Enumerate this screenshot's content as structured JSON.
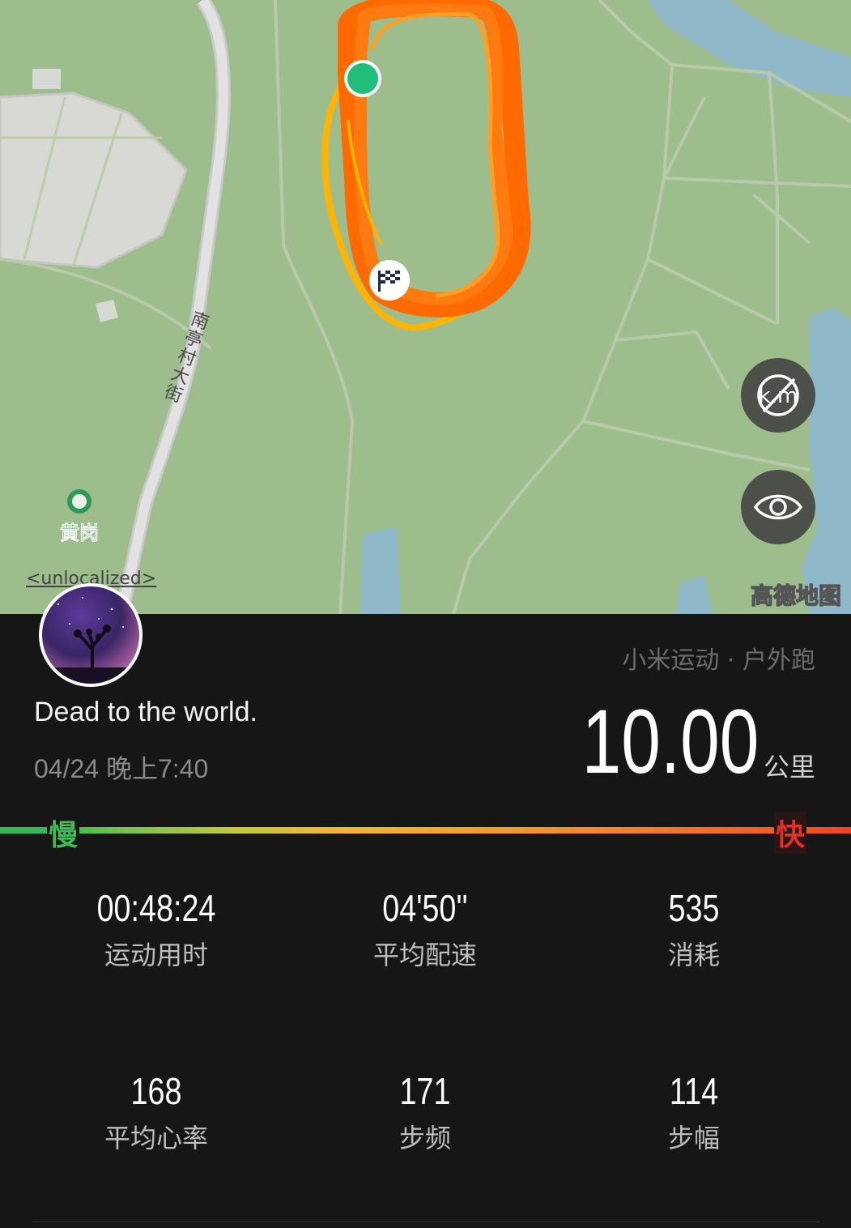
{
  "map": {
    "road_name": "南亭村大街",
    "poi_name": "黄岗",
    "unlocalized_text": "<unlocalized>",
    "provider_logo": "高德地图",
    "buttons": [
      {
        "name": "km-marker-toggle",
        "icon": "km-off-icon"
      },
      {
        "name": "visibility-toggle",
        "icon": "eye-icon"
      }
    ],
    "colors": {
      "land": "#9dbd8c",
      "road": "#c9c9c9",
      "water": "#8fb8c9",
      "track_fast": "#ff6600",
      "track_slow": "#ffb400",
      "start": "#1fbf7a"
    }
  },
  "workout": {
    "source": "小米运动 · 户外跑",
    "username": "Dead to the world.",
    "datetime": "04/24 晚上7:40",
    "distance": "10.00",
    "distance_unit": "公里"
  },
  "pace_legend": {
    "slow": "慢",
    "fast": "快"
  },
  "stats": [
    {
      "value": "00:48:24",
      "label": "运动用时"
    },
    {
      "value": "04'50''",
      "label": "平均配速"
    },
    {
      "value": "535",
      "label": "消耗"
    },
    {
      "value": "168",
      "label": "平均心率"
    },
    {
      "value": "171",
      "label": "步频"
    },
    {
      "value": "114",
      "label": "步幅"
    }
  ]
}
